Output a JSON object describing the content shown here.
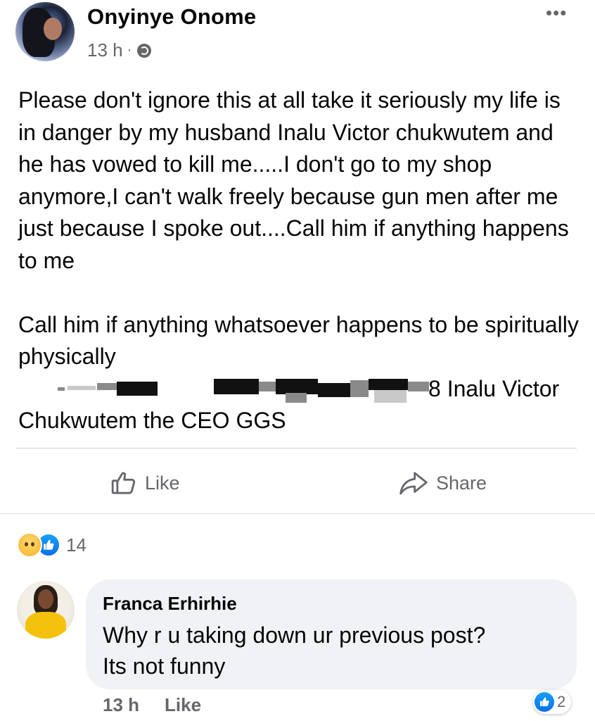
{
  "post": {
    "author": "Onyinye Onome",
    "time": "13 h",
    "separator": "·",
    "privacy_icon": "globe-icon",
    "more_icon": "more-options-icon",
    "paragraph1": "Please don't ignore this at all take it seriously my life is in danger by my husband Inalu Victor chukwutem and he has vowed to kill me.....I don't go to my shop anymore,I can't walk freely because gun men after me just because I spoke out....Call him if anything happens to me",
    "paragraph2_line1": "Call him if anything whatsoever happens to be spiritually physically",
    "redacted_line_tail": "8 Inalu Victor",
    "last_line": "Chukwutem the CEO GGS"
  },
  "actions": {
    "like_label": "Like",
    "share_label": "Share"
  },
  "reactions": {
    "icons": [
      "sad-icon",
      "like-icon"
    ],
    "count": "14"
  },
  "comment": {
    "author": "Franca Erhirhie",
    "line1": "Why r u taking down ur previous post?",
    "line2": "Its not funny",
    "time": "13 h",
    "like_label": "Like",
    "reaction_count": "2"
  },
  "colors": {
    "secondary_text": "#65676b",
    "bubble_bg": "#f0f2f5",
    "like_blue": "#0a6ee8"
  }
}
